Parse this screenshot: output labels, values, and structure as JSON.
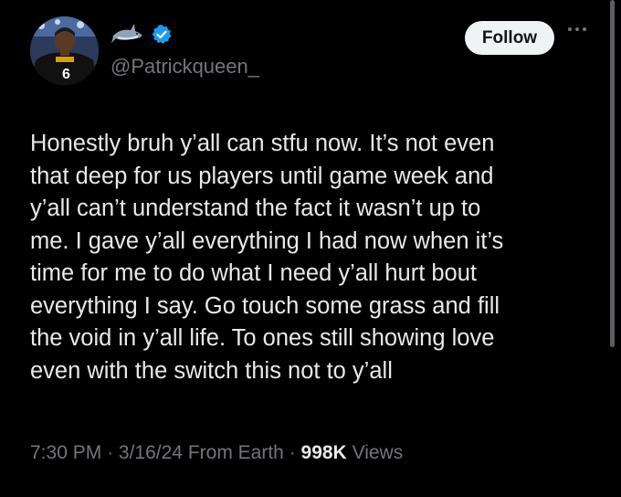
{
  "author": {
    "handle": "@Patrickqueen_",
    "name_icons": [
      "shark-icon",
      "verified-badge-icon"
    ],
    "jersey_number": "6"
  },
  "follow_button": {
    "label": "Follow"
  },
  "tweet": {
    "text": "Honestly bruh y’all can stfu now. It’s not even\nthat deep for us players until game week and\ny’all can’t understand the fact it wasn’t up to\nme. I gave y’all everything I had now when it’s\ntime for me to do what I need y’all hurt bout\neverything I say. Go touch some grass and fill\nthe void in y’all life. To ones still showing love\neven with the switch this not to y’all"
  },
  "meta": {
    "time": "7:30 PM",
    "date": "3/16/24",
    "location": "From Earth",
    "views_count": "998K",
    "views_label": "Views"
  },
  "colors": {
    "background": "#000000",
    "text": "#e7e9ea",
    "secondary_text": "#71767b",
    "verified": "#1d9bf0",
    "button_bg": "#eff3f4"
  }
}
